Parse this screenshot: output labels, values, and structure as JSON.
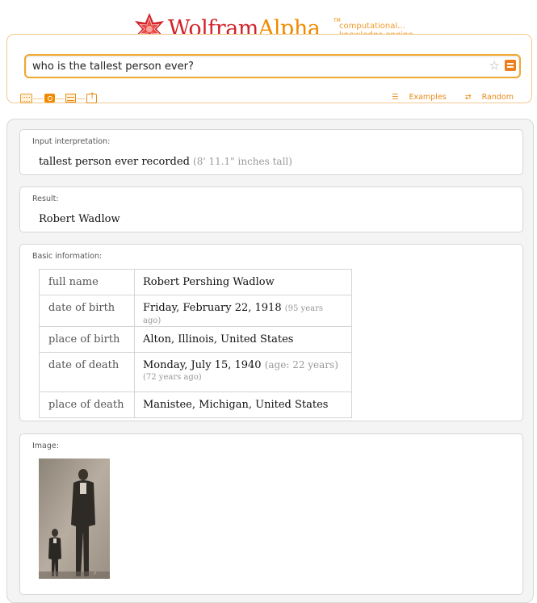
{
  "logo": {
    "part1": "Wolfram",
    "part2": "Alpha",
    "tm": "TM",
    "tagline1": "computational...",
    "tagline2": "knowledge engine"
  },
  "search": {
    "query": "who is the tallest person ever?"
  },
  "links": {
    "examples": "Examples",
    "random": "Random"
  },
  "pods": {
    "input": {
      "title": "Input interpretation:",
      "text": "tallest person ever recorded",
      "note": "(8' 11.1\" inches tall)"
    },
    "result": {
      "title": "Result:",
      "text": "Robert Wadlow"
    },
    "basic": {
      "title": "Basic information:",
      "rows": [
        {
          "key": "full name",
          "value": "Robert Pershing Wadlow",
          "note": ""
        },
        {
          "key": "date of birth",
          "value": "Friday, February 22, 1918",
          "note": "(95 years ago)"
        },
        {
          "key": "place of birth",
          "value": "Alton, Illinois, United States",
          "note": ""
        },
        {
          "key": "date of death",
          "value": "Monday, July 15, 1940",
          "age": "(age: 22 years)",
          "note": "(72 years ago)"
        },
        {
          "key": "place of death",
          "value": "Manistee, Michigan, United States",
          "note": ""
        }
      ]
    },
    "image": {
      "title": "Image:"
    }
  },
  "colors": {
    "brand_red": "#d2232a",
    "brand_orange": "#f08a00"
  }
}
